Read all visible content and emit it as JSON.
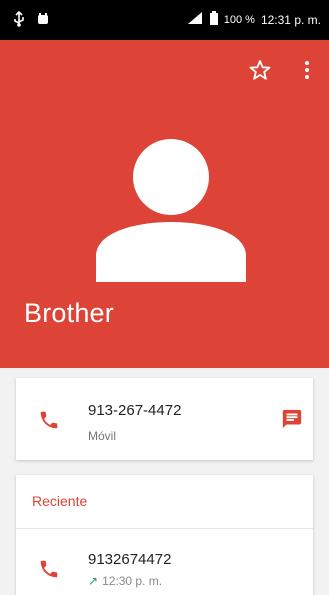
{
  "status_bar": {
    "battery": "100 %",
    "time": "12:31 p. m."
  },
  "contact": {
    "name": "Brother",
    "phone_number": "913-267-4472",
    "phone_type": "Móvil"
  },
  "recent": {
    "title": "Reciente",
    "number": "9132674472",
    "time": "12:30 p. m."
  },
  "colors": {
    "accent": "#dd4337",
    "call_out_arrow": "#27a36a"
  },
  "icons": [
    "usb-icon",
    "android-icon",
    "signal-icon",
    "battery-icon",
    "star-icon",
    "more-vert-icon",
    "avatar-icon",
    "phone-icon",
    "message-icon"
  ]
}
